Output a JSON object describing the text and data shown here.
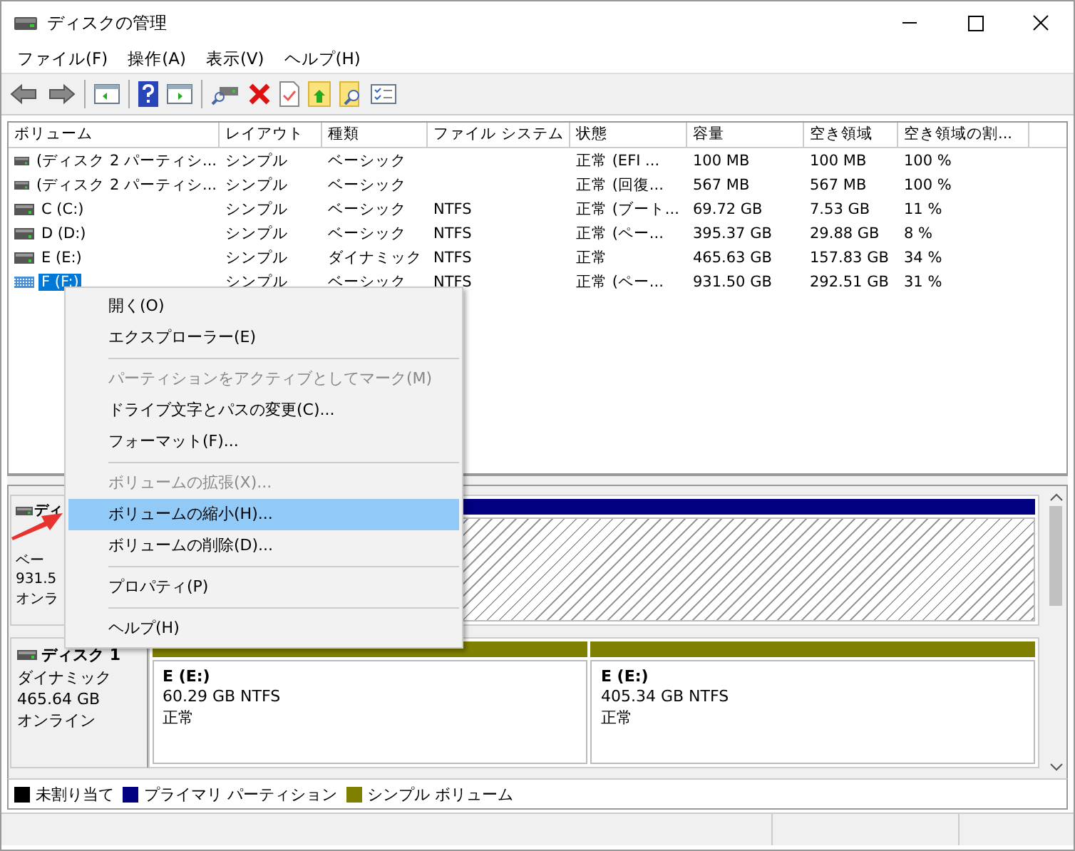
{
  "window": {
    "title": "ディスクの管理"
  },
  "menu_bar": [
    "ファイル(F)",
    "操作(A)",
    "表示(V)",
    "ヘルプ(H)"
  ],
  "table": {
    "columns": [
      "ボリューム",
      "レイアウト",
      "種類",
      "ファイル システム",
      "状態",
      "容量",
      "空き領域",
      "空き領域の割..."
    ],
    "rows": [
      {
        "cells": [
          "(ディスク 2 パーティシ...",
          "シンプル",
          "ベーシック",
          "",
          "正常 (EFI ...",
          "100 MB",
          "100 MB",
          "100 %"
        ],
        "selected": false
      },
      {
        "cells": [
          "(ディスク 2 パーティシ...",
          "シンプル",
          "ベーシック",
          "",
          "正常 (回復...",
          "567 MB",
          "567 MB",
          "100 %"
        ],
        "selected": false
      },
      {
        "cells": [
          "C (C:)",
          "シンプル",
          "ベーシック",
          "NTFS",
          "正常 (ブート...",
          "69.72 GB",
          "7.53 GB",
          "11 %"
        ],
        "selected": false
      },
      {
        "cells": [
          "D (D:)",
          "シンプル",
          "ベーシック",
          "NTFS",
          "正常 (ペー...",
          "395.37 GB",
          "29.88 GB",
          "8 %"
        ],
        "selected": false
      },
      {
        "cells": [
          "E (E:)",
          "シンプル",
          "ダイナミック",
          "NTFS",
          "正常",
          "465.63 GB",
          "157.83 GB",
          "34 %"
        ],
        "selected": false
      },
      {
        "cells": [
          "F (F:)",
          "シンプル",
          "ベーシック",
          "NTFS",
          "正常 (ペー...",
          "931.50 GB",
          "292.51 GB",
          "31 %"
        ],
        "selected": true
      }
    ]
  },
  "disks": [
    {
      "name": "ディ",
      "lines": [
        "ベー",
        "931.5",
        "オンラ"
      ],
      "partitions": [
        {
          "color": "#000080",
          "selected": true
        }
      ]
    },
    {
      "name": "ディスク 1",
      "lines": [
        "ダイナミック",
        "465.64 GB",
        "オンライン"
      ],
      "partitions": [
        {
          "color": "#808000",
          "selected": false,
          "name": "E  (E:)",
          "size": "60.29 GB NTFS",
          "status": "正常"
        },
        {
          "color": "#808000",
          "selected": false,
          "name": "E  (E:)",
          "size": "405.34 GB NTFS",
          "status": "正常"
        }
      ]
    }
  ],
  "legend": [
    {
      "label": "未割り当て",
      "color": "#000000"
    },
    {
      "label": "プライマリ パーティション",
      "color": "#000080"
    },
    {
      "label": "シンプル ボリューム",
      "color": "#808000"
    }
  ],
  "context_menu": [
    {
      "kind": "item",
      "label": "開く(O)",
      "disabled": false,
      "selected": false
    },
    {
      "kind": "item",
      "label": "エクスプローラー(E)",
      "disabled": false,
      "selected": false
    },
    {
      "kind": "separator"
    },
    {
      "kind": "item",
      "label": "パーティションをアクティブとしてマーク(M)",
      "disabled": true,
      "selected": false
    },
    {
      "kind": "item",
      "label": "ドライブ文字とパスの変更(C)...",
      "disabled": false,
      "selected": false
    },
    {
      "kind": "item",
      "label": "フォーマット(F)...",
      "disabled": false,
      "selected": false
    },
    {
      "kind": "separator"
    },
    {
      "kind": "item",
      "label": "ボリュームの拡張(X)...",
      "disabled": true,
      "selected": false
    },
    {
      "kind": "item",
      "label": "ボリュームの縮小(H)...",
      "disabled": false,
      "selected": true
    },
    {
      "kind": "item",
      "label": "ボリュームの削除(D)...",
      "disabled": false,
      "selected": false
    },
    {
      "kind": "separator"
    },
    {
      "kind": "item",
      "label": "プロパティ(P)",
      "disabled": false,
      "selected": false
    },
    {
      "kind": "separator"
    },
    {
      "kind": "item",
      "label": "ヘルプ(H)",
      "disabled": false,
      "selected": false
    }
  ]
}
